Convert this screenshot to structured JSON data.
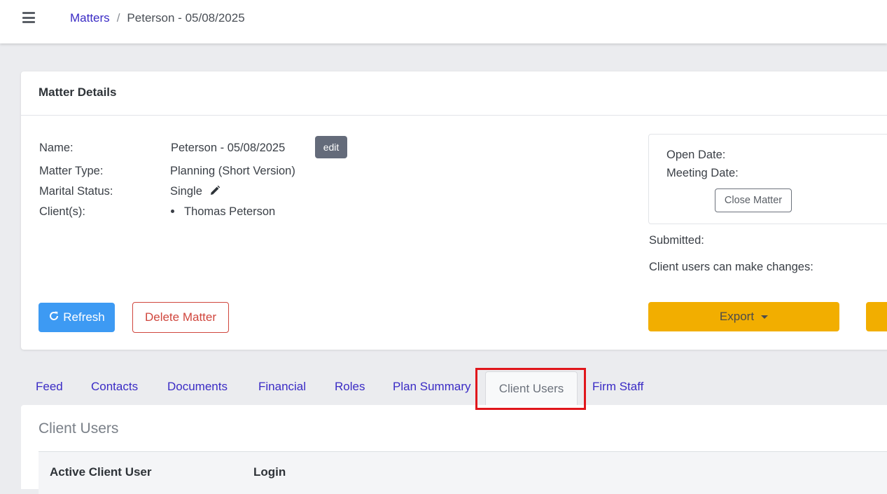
{
  "breadcrumb": {
    "root": "Matters",
    "separator": "/",
    "current": "Peterson - 05/08/2025"
  },
  "matter_details": {
    "title": "Matter Details",
    "name_label": "Name:",
    "name_value": "Peterson - 05/08/2025",
    "edit_label": "edit",
    "type_label": "Matter Type:",
    "type_value": "Planning (Short Version)",
    "marital_label": "Marital Status:",
    "marital_value": "Single",
    "clients_label": "Client(s):",
    "clients": [
      "Thomas Peterson"
    ],
    "open_date_label": "Open Date:",
    "meeting_date_label": "Meeting Date:",
    "close_label": "Close Matter",
    "submitted_label": "Submitted:",
    "client_changes_label": "Client users can make changes:"
  },
  "actions": {
    "refresh": "Refresh",
    "delete": "Delete Matter",
    "export": "Export"
  },
  "tabs": [
    {
      "label": "Feed"
    },
    {
      "label": "Contacts"
    },
    {
      "label": "Documents"
    },
    {
      "label": "Financial"
    },
    {
      "label": "Roles"
    },
    {
      "label": "Plan Summary"
    },
    {
      "label": "Client Users",
      "active": true
    },
    {
      "label": "Firm Staff"
    }
  ],
  "client_users": {
    "title": "Client Users",
    "columns": [
      "Active Client User",
      "Login"
    ]
  },
  "colors": {
    "link": "#3a2bc5",
    "refresh": "#3d9af3",
    "export": "#f2ae00",
    "delete": "#d0463d",
    "highlight": "#e0161b"
  }
}
